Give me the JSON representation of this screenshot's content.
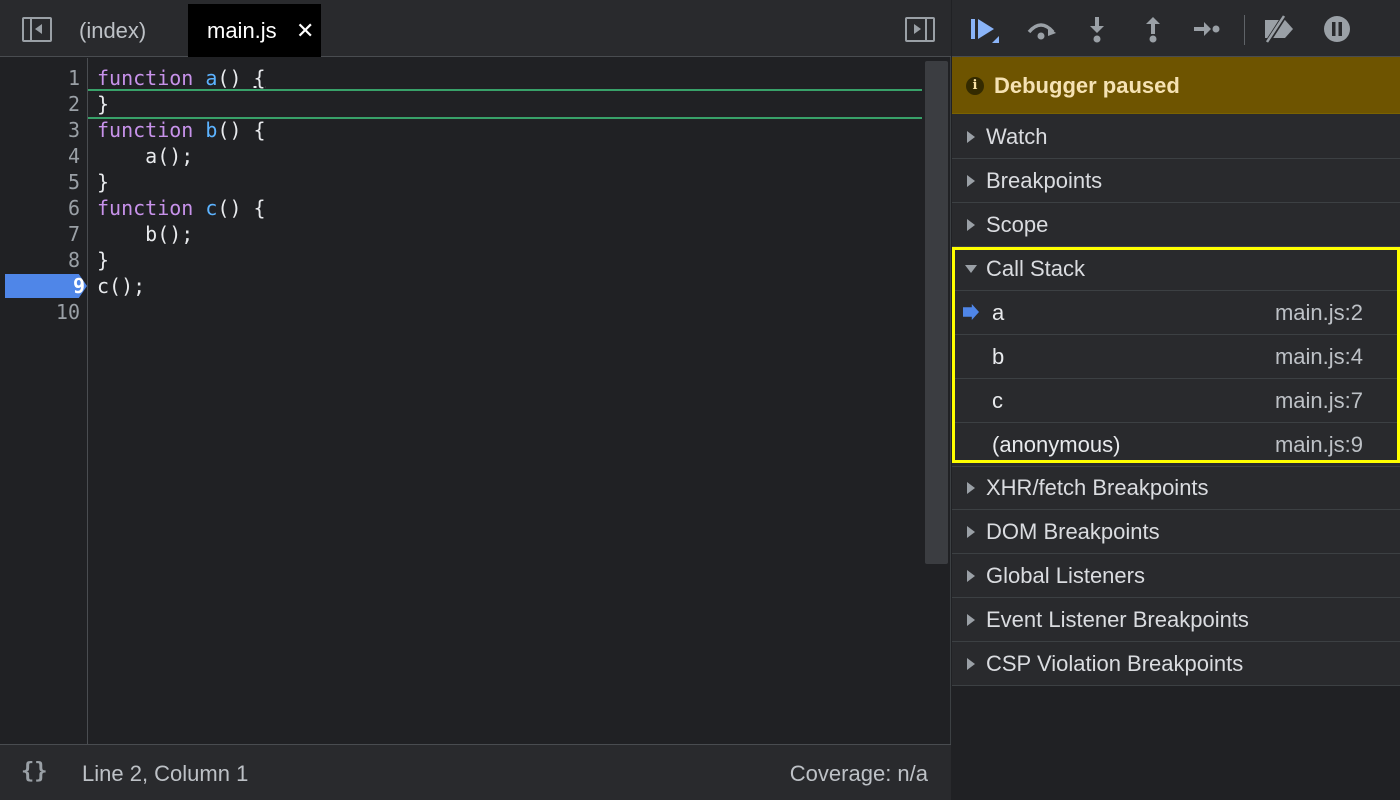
{
  "tabs": [
    {
      "label": "(index)"
    },
    {
      "label": "main.js"
    }
  ],
  "tab_close_glyph": "✕",
  "editor": {
    "line_numbers": [
      "1",
      "2",
      "3",
      "4",
      "5",
      "6",
      "7",
      "8",
      "9",
      "10"
    ],
    "current_line": "9",
    "code": {
      "l1_kw": "function",
      "l1_fn": "a",
      "l1_rest": "() ",
      "l1_brace": "{",
      "l2": "}",
      "l3_kw": "function",
      "l3_fn": "b",
      "l3_rest": "() {",
      "l4": "    a();",
      "l5": "}",
      "l6_kw": "function",
      "l6_fn": "c",
      "l6_rest": "() {",
      "l7": "    b();",
      "l8": "}",
      "l9": "c();",
      "l10": ""
    }
  },
  "status_bar": {
    "braces": "{}",
    "position": "Line 2, Column 1",
    "coverage": "Coverage: n/a"
  },
  "debugger": {
    "toolbar_icons": [
      "resume-icon",
      "step-over-icon",
      "step-into-icon",
      "step-out-icon",
      "step-icon",
      "deactivate-breakpoints-icon",
      "pause-on-exceptions-icon"
    ],
    "paused_icon": "i",
    "paused_text": "Debugger paused",
    "sections_top": [
      "Watch",
      "Breakpoints",
      "Scope"
    ],
    "call_stack_label": "Call Stack",
    "call_stack": [
      {
        "name": "a",
        "location": "main.js:2",
        "current": true
      },
      {
        "name": "b",
        "location": "main.js:4"
      },
      {
        "name": "c",
        "location": "main.js:7"
      },
      {
        "name": "(anonymous)",
        "location": "main.js:9"
      }
    ],
    "sections_bottom": [
      "XHR/fetch Breakpoints",
      "DOM Breakpoints",
      "Global Listeners",
      "Event Listener Breakpoints",
      "CSP Violation Breakpoints"
    ]
  },
  "colors": {
    "accent": "#4f86e8",
    "highlight": "#ffff00",
    "paused_banner": "#6e5400",
    "keyword": "#c792ea",
    "function_name": "#5cb3ff"
  }
}
